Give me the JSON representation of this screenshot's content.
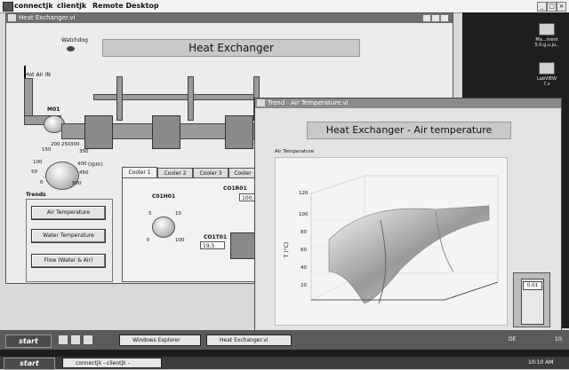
{
  "outer_window": {
    "menu_items": [
      "connectjk",
      "clientjk",
      "Remote Desktop"
    ]
  },
  "desktop_icons": [
    {
      "label": "Ma...ment 5.0.g.u.ju.."
    },
    {
      "label": "LabVIEW 7.x"
    }
  ],
  "vi_window": {
    "title": "Heat Exchanger.vi",
    "header": "Heat Exchanger",
    "watchdog_label": "Watchdog",
    "hot_air_label": "Hot Air IN",
    "motor_label": "M01",
    "rpm_label": "(rpm)",
    "rpm_ticks": [
      "150",
      "200",
      "250",
      "300",
      "350",
      "100",
      "400",
      "50",
      "450",
      "0",
      "500"
    ],
    "trends_label": "Trends",
    "trend_buttons": [
      "Air Temperature",
      "Water Temperature",
      "Flow (Water & Air)"
    ],
    "cooler_tabs": [
      "Cooler 1",
      "Cooler 2",
      "Cooler 3",
      "Cooler"
    ],
    "cooler_knob_label": "C01H01",
    "knob_ticks": [
      "0",
      "5",
      "10",
      "100"
    ],
    "co1r01_label": "CO1R01",
    "co1r01_value": "100,00",
    "co1t01_label": "CO1T01",
    "co1t01_value": "19,5"
  },
  "trend_window": {
    "title": "Trend - Air Temperature.vi",
    "header": "Heat Exchanger - Air temperature",
    "graph_label": "Air Temperature",
    "z_axis_label": "T (°C)",
    "z_ticks": [
      "120",
      "100",
      "80",
      "60",
      "40",
      "20"
    ],
    "indicator_value": "0.01"
  },
  "taskbar_top": {
    "start_label": "start",
    "items": [
      "Windows Explorer",
      "Heat Exchanger.vi"
    ],
    "tray_text": "DE",
    "time": "10:"
  },
  "taskbar_bottom": {
    "start_label": "start",
    "items": [
      "connectjk - clientjk -"
    ],
    "time": "10:10 AM"
  }
}
